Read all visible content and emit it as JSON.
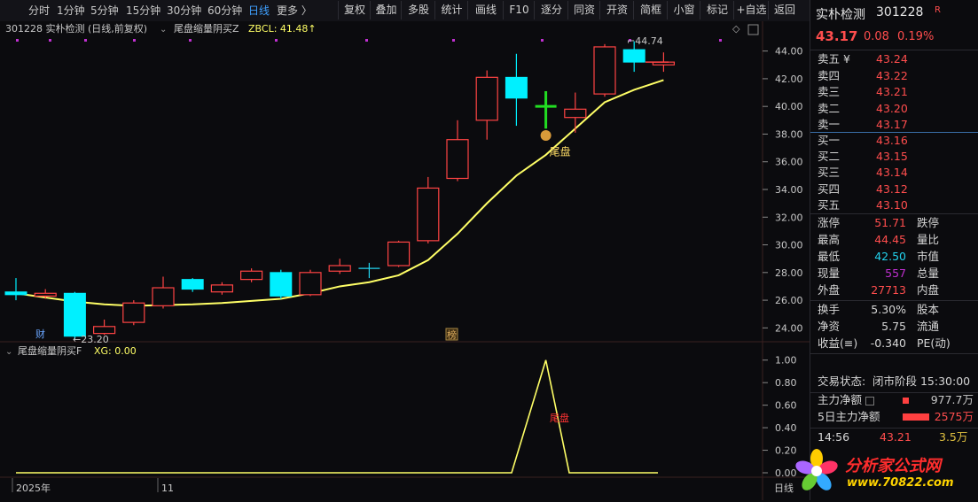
{
  "toolbar": {
    "periods": [
      "分时",
      "1分钟",
      "5分钟",
      "15分钟",
      "30分钟",
      "60分钟",
      "日线",
      "更多 〉"
    ],
    "active_period": "日线",
    "buttons": [
      "复权",
      "叠加",
      "多股",
      "统计",
      "画线",
      "F10",
      "逐分",
      "同资",
      "开资",
      "简框",
      "小窗",
      "标记",
      "+自选",
      "返回"
    ]
  },
  "main_chart": {
    "header": "301228 实朴检测 (日线,前复权)",
    "indicator_name": "尾盘缩量阴买Z",
    "indicator_value": "ZBCL: 41.48↑",
    "max_label": "44.74",
    "min_label": "23.20",
    "marker_cai": "财",
    "marker_bang": "榜",
    "marker_weipan": "尾盘"
  },
  "sub_chart": {
    "header": "尾盘缩量阴买F",
    "value": "XG: 0.00",
    "signal_label": "尾盘"
  },
  "x_axis": {
    "labels": [
      "2025年",
      "11"
    ],
    "right_label": "日线"
  },
  "colors": {
    "up": "#ff4444",
    "down": "#00f0ff",
    "ma": "#ffff66",
    "cross": "#22dd22",
    "bg": "#0b0b0e"
  },
  "chart_data": [
    {
      "type": "candlestick",
      "ylim": [
        23,
        45
      ],
      "yticks": [
        "24.00",
        "26.00",
        "28.00",
        "30.00",
        "32.00",
        "34.00",
        "36.00",
        "38.00",
        "40.00",
        "42.00",
        "44.00"
      ],
      "candles": [
        {
          "o": 26.6,
          "c": 26.4,
          "h": 27.6,
          "l": 26.0,
          "dir": "down"
        },
        {
          "o": 26.3,
          "c": 26.5,
          "h": 26.8,
          "l": 26.1,
          "dir": "up"
        },
        {
          "o": 26.5,
          "c": 23.4,
          "h": 26.6,
          "l": 23.2,
          "dir": "down"
        },
        {
          "o": 23.6,
          "c": 24.1,
          "h": 24.6,
          "l": 23.5,
          "dir": "up"
        },
        {
          "o": 24.4,
          "c": 25.8,
          "h": 26.0,
          "l": 24.2,
          "dir": "up"
        },
        {
          "o": 25.6,
          "c": 26.9,
          "h": 27.7,
          "l": 25.4,
          "dir": "up"
        },
        {
          "o": 27.5,
          "c": 26.8,
          "h": 27.6,
          "l": 26.6,
          "dir": "down"
        },
        {
          "o": 26.6,
          "c": 27.1,
          "h": 27.3,
          "l": 26.4,
          "dir": "up"
        },
        {
          "o": 27.5,
          "c": 28.1,
          "h": 28.3,
          "l": 27.3,
          "dir": "up"
        },
        {
          "o": 28.0,
          "c": 26.3,
          "h": 28.2,
          "l": 26.1,
          "dir": "down"
        },
        {
          "o": 26.4,
          "c": 28.0,
          "h": 28.2,
          "l": 26.3,
          "dir": "up"
        },
        {
          "o": 28.1,
          "c": 28.5,
          "h": 29.0,
          "l": 27.9,
          "dir": "up"
        },
        {
          "o": 28.3,
          "c": 28.3,
          "h": 28.7,
          "l": 27.6,
          "dir": "cross"
        },
        {
          "o": 28.5,
          "c": 30.2,
          "h": 30.3,
          "l": 28.4,
          "dir": "up"
        },
        {
          "o": 30.3,
          "c": 34.1,
          "h": 34.9,
          "l": 30.1,
          "dir": "up"
        },
        {
          "o": 34.8,
          "c": 37.6,
          "h": 39.0,
          "l": 34.6,
          "dir": "up"
        },
        {
          "o": 39.0,
          "c": 42.1,
          "h": 42.6,
          "l": 37.6,
          "dir": "up"
        },
        {
          "o": 42.1,
          "c": 40.6,
          "h": 43.8,
          "l": 38.6,
          "dir": "down"
        },
        {
          "o": 40.0,
          "c": 40.0,
          "h": 41.1,
          "l": 38.4,
          "dir": "cross"
        },
        {
          "o": 39.2,
          "c": 39.8,
          "h": 41.0,
          "l": 38.1,
          "dir": "up"
        },
        {
          "o": 40.9,
          "c": 44.3,
          "h": 44.5,
          "l": 40.7,
          "dir": "up"
        },
        {
          "o": 44.1,
          "c": 43.2,
          "h": 44.7,
          "l": 42.5,
          "dir": "down"
        },
        {
          "o": 43.0,
          "c": 43.2,
          "h": 43.9,
          "l": 42.5,
          "dir": "up"
        }
      ],
      "ma": [
        26.5,
        26.2,
        25.9,
        25.7,
        25.6,
        25.65,
        25.7,
        25.8,
        25.95,
        26.1,
        26.5,
        27.0,
        27.3,
        27.8,
        28.9,
        30.8,
        33.0,
        35.0,
        36.5,
        38.4,
        40.3,
        41.2,
        41.9
      ],
      "bang_index": 15,
      "weipan_index": 18
    },
    {
      "type": "line",
      "ylim": [
        0,
        1.1
      ],
      "yticks": [
        "1.00",
        "0.80",
        "0.60",
        "0.40",
        "0.20",
        "0.00"
      ],
      "x": [
        0,
        17,
        18,
        19,
        22
      ],
      "y": [
        0,
        0,
        1,
        0,
        0
      ]
    }
  ],
  "quote_panel": {
    "name": "实朴检测",
    "code": "301228",
    "badge": "R",
    "price": "43.17",
    "change": "0.08",
    "change_pct": "0.19%",
    "asks": [
      {
        "label": "卖五 ¥",
        "price": "43.24"
      },
      {
        "label": "卖四",
        "price": "43.22"
      },
      {
        "label": "卖三",
        "price": "43.21"
      },
      {
        "label": "卖二",
        "price": "43.20"
      },
      {
        "label": "卖一",
        "price": "43.17"
      }
    ],
    "bids": [
      {
        "label": "买一",
        "price": "43.16"
      },
      {
        "label": "买二",
        "price": "43.15"
      },
      {
        "label": "买三",
        "price": "43.14"
      },
      {
        "label": "买四",
        "price": "43.12"
      },
      {
        "label": "买五",
        "price": "43.10"
      }
    ],
    "stats": [
      {
        "l1": "涨停",
        "v1": "51.71",
        "c1": "red",
        "l2": "跌停"
      },
      {
        "l1": "最高",
        "v1": "44.45",
        "c1": "red",
        "l2": "量比"
      },
      {
        "l1": "最低",
        "v1": "42.50",
        "c1": "cyan",
        "l2": "市值"
      },
      {
        "l1": "现量",
        "v1": "557",
        "c1": "purple",
        "l2": "总量"
      },
      {
        "l1": "外盘",
        "v1": "27713",
        "c1": "red",
        "l2": "内盘"
      }
    ],
    "stats2": [
      {
        "l1": "换手",
        "v1": "5.30%",
        "l2": "股本"
      },
      {
        "l1": "净资",
        "v1": "5.75",
        "l2": "流通"
      },
      {
        "l1": "收益(≡)",
        "v1": "-0.340",
        "l2": "PE(动)"
      }
    ],
    "status_label": "交易状态:",
    "status_value": "闭市阶段 15:30:00",
    "main_flow_label": "主力净额",
    "main_flow_value": "977.7万",
    "flow5_label": "5日主力净额",
    "flow5_value": "2575万",
    "tick_time": "14:56",
    "tick_price": "43.21",
    "tick_vol": "3.5万"
  },
  "watermark": {
    "title": "分析家公式网",
    "url": "www.70822.com"
  }
}
